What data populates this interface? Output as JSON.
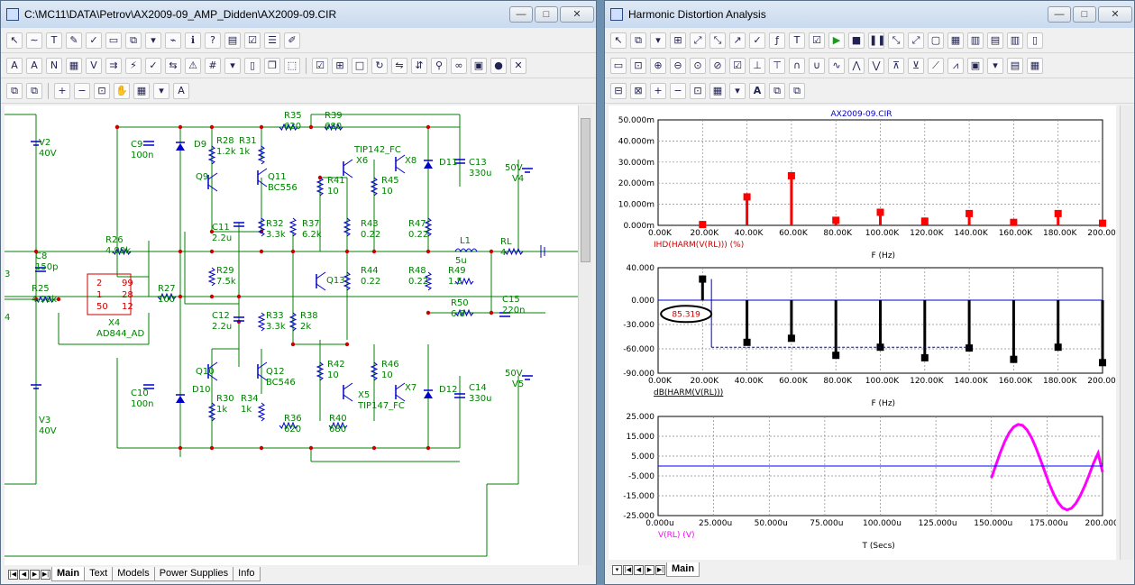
{
  "left_window": {
    "title": "C:\\MC11\\DATA\\Petrov\\AX2009-09_AMP_Didden\\AX2009-09.CIR",
    "tabs": [
      "Main",
      "Text",
      "Models",
      "Power Supplies",
      "Info"
    ],
    "active_tab": "Main"
  },
  "right_window": {
    "title": "Harmonic Distortion Analysis",
    "tabs": [
      "Main"
    ],
    "active_tab": "Main"
  },
  "window_controls": {
    "minimize": "—",
    "maximize": "□",
    "close": "✕"
  },
  "schematic": {
    "resistors": [
      {
        "name": "R35",
        "value": "620"
      },
      {
        "name": "R39",
        "value": "680"
      },
      {
        "name": "R28",
        "value": "1.2k"
      },
      {
        "name": "R31",
        "value": "1k"
      },
      {
        "name": "R26",
        "value": "4.99k"
      },
      {
        "name": "R25",
        "value": "4.99k"
      },
      {
        "name": "R27",
        "value": "100"
      },
      {
        "name": "R29",
        "value": "7.5k"
      },
      {
        "name": "R32",
        "value": "3.3k"
      },
      {
        "name": "R37",
        "value": "6.2k"
      },
      {
        "name": "R33",
        "value": "3.3k"
      },
      {
        "name": "R38",
        "value": "2k"
      },
      {
        "name": "R41",
        "value": "10"
      },
      {
        "name": "R45",
        "value": "10"
      },
      {
        "name": "R43",
        "value": "0.22"
      },
      {
        "name": "R47",
        "value": "0.22"
      },
      {
        "name": "R44",
        "value": "0.22"
      },
      {
        "name": "R48",
        "value": "0.22"
      },
      {
        "name": "R42",
        "value": "10"
      },
      {
        "name": "R46",
        "value": "10"
      },
      {
        "name": "R49",
        "value": "1.5"
      },
      {
        "name": "R50",
        "value": "6.8"
      },
      {
        "name": "R30",
        "value": "1k"
      },
      {
        "name": "R34",
        "value": "1k"
      },
      {
        "name": "R36",
        "value": "620"
      },
      {
        "name": "R40",
        "value": "680"
      },
      {
        "name": "RL",
        "value": "4"
      }
    ],
    "capacitors": [
      {
        "name": "C9",
        "value": "100n"
      },
      {
        "name": "C8",
        "value": "150p"
      },
      {
        "name": "C11",
        "value": "2.2u"
      },
      {
        "name": "C12",
        "value": "2.2u"
      },
      {
        "name": "C10",
        "value": "100n"
      },
      {
        "name": "C13",
        "value": "330u"
      },
      {
        "name": "C14",
        "value": "330u"
      },
      {
        "name": "C15",
        "value": "220n"
      }
    ],
    "sources": [
      {
        "name": "V2",
        "value": "40V"
      },
      {
        "name": "V3",
        "value": "40V"
      },
      {
        "name": "V4",
        "value": "50V"
      },
      {
        "name": "V5",
        "value": "50V"
      }
    ],
    "transistors": [
      {
        "name": "Q9"
      },
      {
        "name": "Q11",
        "value": "BC556"
      },
      {
        "name": "Q13"
      },
      {
        "name": "Q10"
      },
      {
        "name": "Q12",
        "value": "BC546"
      },
      {
        "name": "X6",
        "value": "TIP142_FC"
      },
      {
        "name": "X8"
      },
      {
        "name": "X5",
        "value": "TIP147_FC"
      },
      {
        "name": "X7"
      }
    ],
    "diodes": [
      "D9",
      "D10",
      "D11",
      "D12"
    ],
    "inductor": {
      "name": "L1",
      "value": "5u"
    },
    "opamp": {
      "name": "X4",
      "value": "AD844_AD",
      "pins": [
        "2",
        "1",
        "50",
        "99",
        "28",
        "12"
      ]
    },
    "edge_labels": [
      "3",
      "4"
    ]
  },
  "chart_data": [
    {
      "type": "bar",
      "title": "AX2009-09.CIR",
      "xlabel": "F (Hz)",
      "ylabel": "IHD(HARM(V(RL))) (%)",
      "x": [
        20000,
        40000,
        60000,
        80000,
        100000,
        120000,
        140000,
        160000,
        180000,
        200000
      ],
      "values": [
        0.4,
        13.5,
        23.5,
        2.4,
        6.2,
        2.0,
        5.6,
        1.4,
        5.6,
        1.0
      ],
      "xlim": [
        0,
        200000
      ],
      "ylim": [
        0,
        50
      ],
      "x_ticks": [
        "0.00K",
        "20.00K",
        "40.00K",
        "60.00K",
        "80.00K",
        "100.00K",
        "120.00K",
        "140.00K",
        "160.00K",
        "180.00K",
        "200.00K"
      ],
      "y_ticks": [
        "50.000m",
        "40.000m",
        "30.000m",
        "20.000m",
        "10.000m",
        "0.000m"
      ],
      "color": "#ff0000",
      "grid": true
    },
    {
      "type": "bar",
      "xlabel": "F (Hz)",
      "ylabel": "dB(HARM(V(RL)))",
      "x": [
        20000,
        40000,
        60000,
        80000,
        100000,
        120000,
        140000,
        160000,
        180000,
        200000
      ],
      "values": [
        26,
        -52,
        -47,
        -68,
        -58,
        -71,
        -59,
        -73,
        -58,
        -77
      ],
      "xlim": [
        0,
        200000
      ],
      "ylim": [
        -90,
        40
      ],
      "x_ticks": [
        "0.00K",
        "20.00K",
        "40.00K",
        "60.00K",
        "80.00K",
        "100.00K",
        "120.00K",
        "140.00K",
        "160.00K",
        "180.00K",
        "200.00K"
      ],
      "y_ticks": [
        "40.000",
        "0.000",
        "-30.000",
        "-60.000",
        "-90.000"
      ],
      "annotation": "85.319",
      "color": "#000000",
      "grid": true
    },
    {
      "type": "line",
      "xlabel": "T (Secs)",
      "ylabel": "V(RL) (V)",
      "xlim": [
        0,
        200
      ],
      "ylim": [
        -25,
        25
      ],
      "x_unit": "u",
      "x_ticks": [
        "0.000u",
        "25.000u",
        "50.000u",
        "75.000u",
        "100.000u",
        "125.000u",
        "150.000u",
        "175.000u",
        "200.000u"
      ],
      "y_ticks": [
        "25.000",
        "15.000",
        "5.000",
        "-5.000",
        "-15.000",
        "-25.000"
      ],
      "series": [
        {
          "color": "#ff00ff",
          "x": [
            150,
            152,
            154,
            156,
            158,
            160,
            162,
            164,
            166,
            168,
            170,
            172,
            174,
            176,
            178,
            180,
            182,
            184,
            186,
            188,
            190,
            192,
            194,
            196,
            198,
            200
          ],
          "values": [
            -6,
            0.5,
            6.8,
            12.4,
            16.8,
            19.7,
            21,
            20.5,
            18.2,
            14.4,
            9.3,
            3.4,
            -2.8,
            -8.9,
            -14.2,
            -18.4,
            -21.1,
            -22.1,
            -21.3,
            -18.8,
            -14.9,
            -10,
            -4.4,
            1.6,
            6.5,
            -3
          ]
        },
        {
          "color": "#0000ff",
          "x": [
            0,
            200
          ],
          "values": [
            0,
            0
          ]
        }
      ],
      "grid": true
    }
  ]
}
